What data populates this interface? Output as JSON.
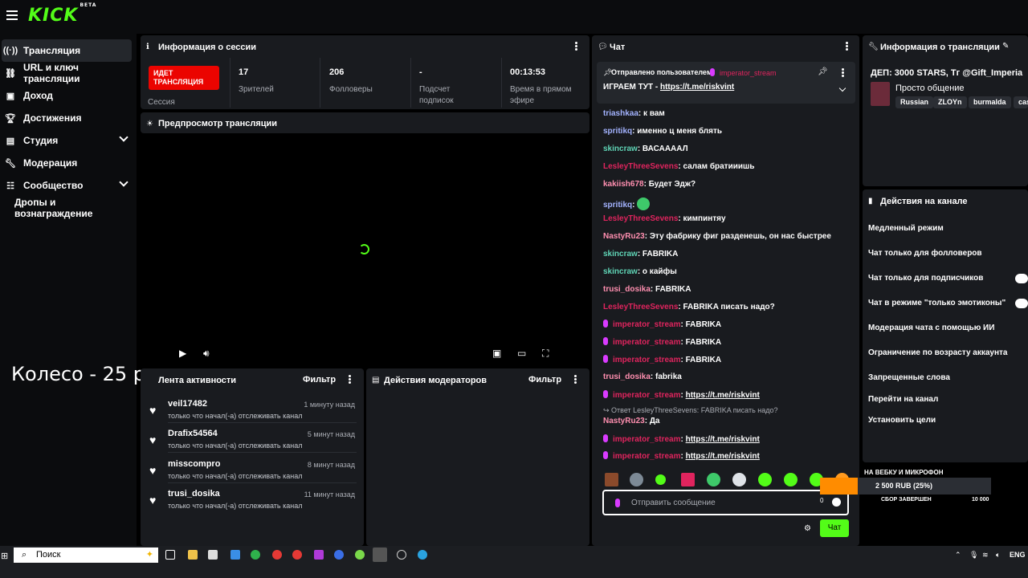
{
  "app": {
    "logo": "KICK",
    "logo_badge": "BETA"
  },
  "sidebar": {
    "items": [
      {
        "label": "Трансляция",
        "icon": "broadcast-icon"
      },
      {
        "label": "URL и ключ трансляции",
        "icon": "link-icon"
      },
      {
        "label": "Доход",
        "icon": "revenue-icon"
      },
      {
        "label": "Достижения",
        "icon": "trophy-icon"
      },
      {
        "label": "Студия",
        "icon": "studio-icon"
      },
      {
        "label": "Модерация",
        "icon": "wrench-icon"
      },
      {
        "label": "Сообщество",
        "icon": "community-icon"
      },
      {
        "label": "Дропы и вознаграждение",
        "icon": ""
      }
    ]
  },
  "overlay_text": "Колесо - 25 р",
  "session": {
    "title": "Информация о сессии",
    "live_badge": "ИДЕТ ТРАНСЛЯЦИЯ",
    "live_label": "Сессия",
    "stats": [
      {
        "value": "17",
        "label": "Зрителей"
      },
      {
        "value": "206",
        "label": "Фолловеры"
      },
      {
        "value": "-",
        "label": "Подсчет подписок"
      },
      {
        "value": "00:13:53",
        "label": "Время в прямом эфире"
      }
    ]
  },
  "preview": {
    "title": "Предпросмотр трансляции"
  },
  "activity": {
    "title": "Лента активности",
    "filter": "Фильтр",
    "items": [
      {
        "name": "veil17482",
        "time": "1 минуту назад",
        "text": "только что начал(-а) отслеживать канал"
      },
      {
        "name": "Drafix54564",
        "time": "5 минут назад",
        "text": "только что начал(-а) отслеживать канал"
      },
      {
        "name": "misscompro",
        "time": "8 минут назад",
        "text": "только что начал(-а) отслеживать канал"
      },
      {
        "name": "trusi_dosika",
        "time": "11 минут назад",
        "text": "только что начал(-а) отслеживать канал"
      }
    ]
  },
  "mod_actions": {
    "title": "Действия модераторов",
    "filter": "Фильтр"
  },
  "chat": {
    "title": "Чат",
    "pinned_by_label": "Отправлено пользователем",
    "pinned_user": "imperator_stream",
    "pinned_text": "ИГРАЕМ ТУТ - ",
    "pinned_link": "https://t.me/riskvint",
    "messages": [
      {
        "user": "triashkaa",
        "color": "#a3b3ff",
        "text": "к вам"
      },
      {
        "user": "spritikq",
        "color": "#a3b3ff",
        "text": "именно ц меня блять"
      },
      {
        "user": "skincraw",
        "color": "#5fd3b5",
        "text": "ВАСААААЛ"
      },
      {
        "user": "LesleyThreeSevens",
        "color": "#e0245e",
        "text": "салам братииишь"
      },
      {
        "user": "kakiish678",
        "color": "#ff8fb0",
        "text": "Будет Эдж?"
      },
      {
        "user": "spritikq",
        "color": "#a3b3ff",
        "text": ""
      },
      {
        "user": "LesleyThreeSevens",
        "color": "#e0245e",
        "text": "кимпинтяу"
      },
      {
        "user": "NastyRu23",
        "color": "#ff8fb0",
        "text": "Эту фабрику фиг разденешь, он нас быстрее"
      },
      {
        "user": "skincraw",
        "color": "#5fd3b5",
        "text": "FABRIKA"
      },
      {
        "user": "skincraw",
        "color": "#5fd3b5",
        "text": "о кайфы"
      },
      {
        "user": "trusi_dosika",
        "color": "#ff8fb0",
        "text": "FABRIKA"
      },
      {
        "user": "LesleyThreeSevens",
        "color": "#e0245e",
        "text": "FABRIKA писать надо?"
      },
      {
        "user": "imperator_stream",
        "color": "#e0245e",
        "text": "FABRIKA",
        "mic": true
      },
      {
        "user": "imperator_stream",
        "color": "#e0245e",
        "text": "FABRIKA",
        "mic": true
      },
      {
        "user": "imperator_stream",
        "color": "#e0245e",
        "text": "FABRIKA",
        "mic": true
      },
      {
        "user": "trusi_dosika",
        "color": "#ff8fb0",
        "text": "fabrika"
      },
      {
        "user": "imperator_stream",
        "color": "#e0245e",
        "text": "https://t.me/riskvint",
        "mic": true,
        "link": true
      },
      {
        "user": "NastyRu23",
        "color": "#ff8fb0",
        "text": "Да"
      },
      {
        "user": "imperator_stream",
        "color": "#e0245e",
        "text": "https://t.me/riskvint",
        "mic": true,
        "link": true
      },
      {
        "user": "imperator_stream",
        "color": "#e0245e",
        "text": "https://t.me/riskvint",
        "mic": true,
        "link": true
      }
    ],
    "reply_note": "Ответ LesleyThreeSevens: FABRIKA писать надо?",
    "input_placeholder": "Отправить сообщение",
    "char_count": "0",
    "send_label": "Чат"
  },
  "stream_info": {
    "title": "Информация о трансляции",
    "stream_title": "ДЕП: 3000 STARS, Тг @Gift_Imperia",
    "category": "Просто общение",
    "tags": [
      "Russian",
      "ZLOYn",
      "burmalda",
      "cas"
    ]
  },
  "channel_actions": {
    "title": "Действия на канале",
    "items": [
      "Медленный режим",
      "Чат только для фолловеров",
      "Чат только для подписчиков",
      "Чат в режиме \"только эмотиконы\"",
      "Модерация чата с помощью ИИ",
      "Ограничение по возрасту аккаунта",
      "Запрещенные слова",
      "Перейти на канал",
      "Установить цели"
    ]
  },
  "donation": {
    "title": "НА ВЕБКУ И МИКРОФОН",
    "amount": "2 500 RUB (25%)",
    "progress": 0.25,
    "status": "СБОР ЗАВЕРШЕН",
    "goal": "10 000"
  },
  "taskbar": {
    "search_placeholder": "Поиск",
    "lang": "ENG"
  }
}
